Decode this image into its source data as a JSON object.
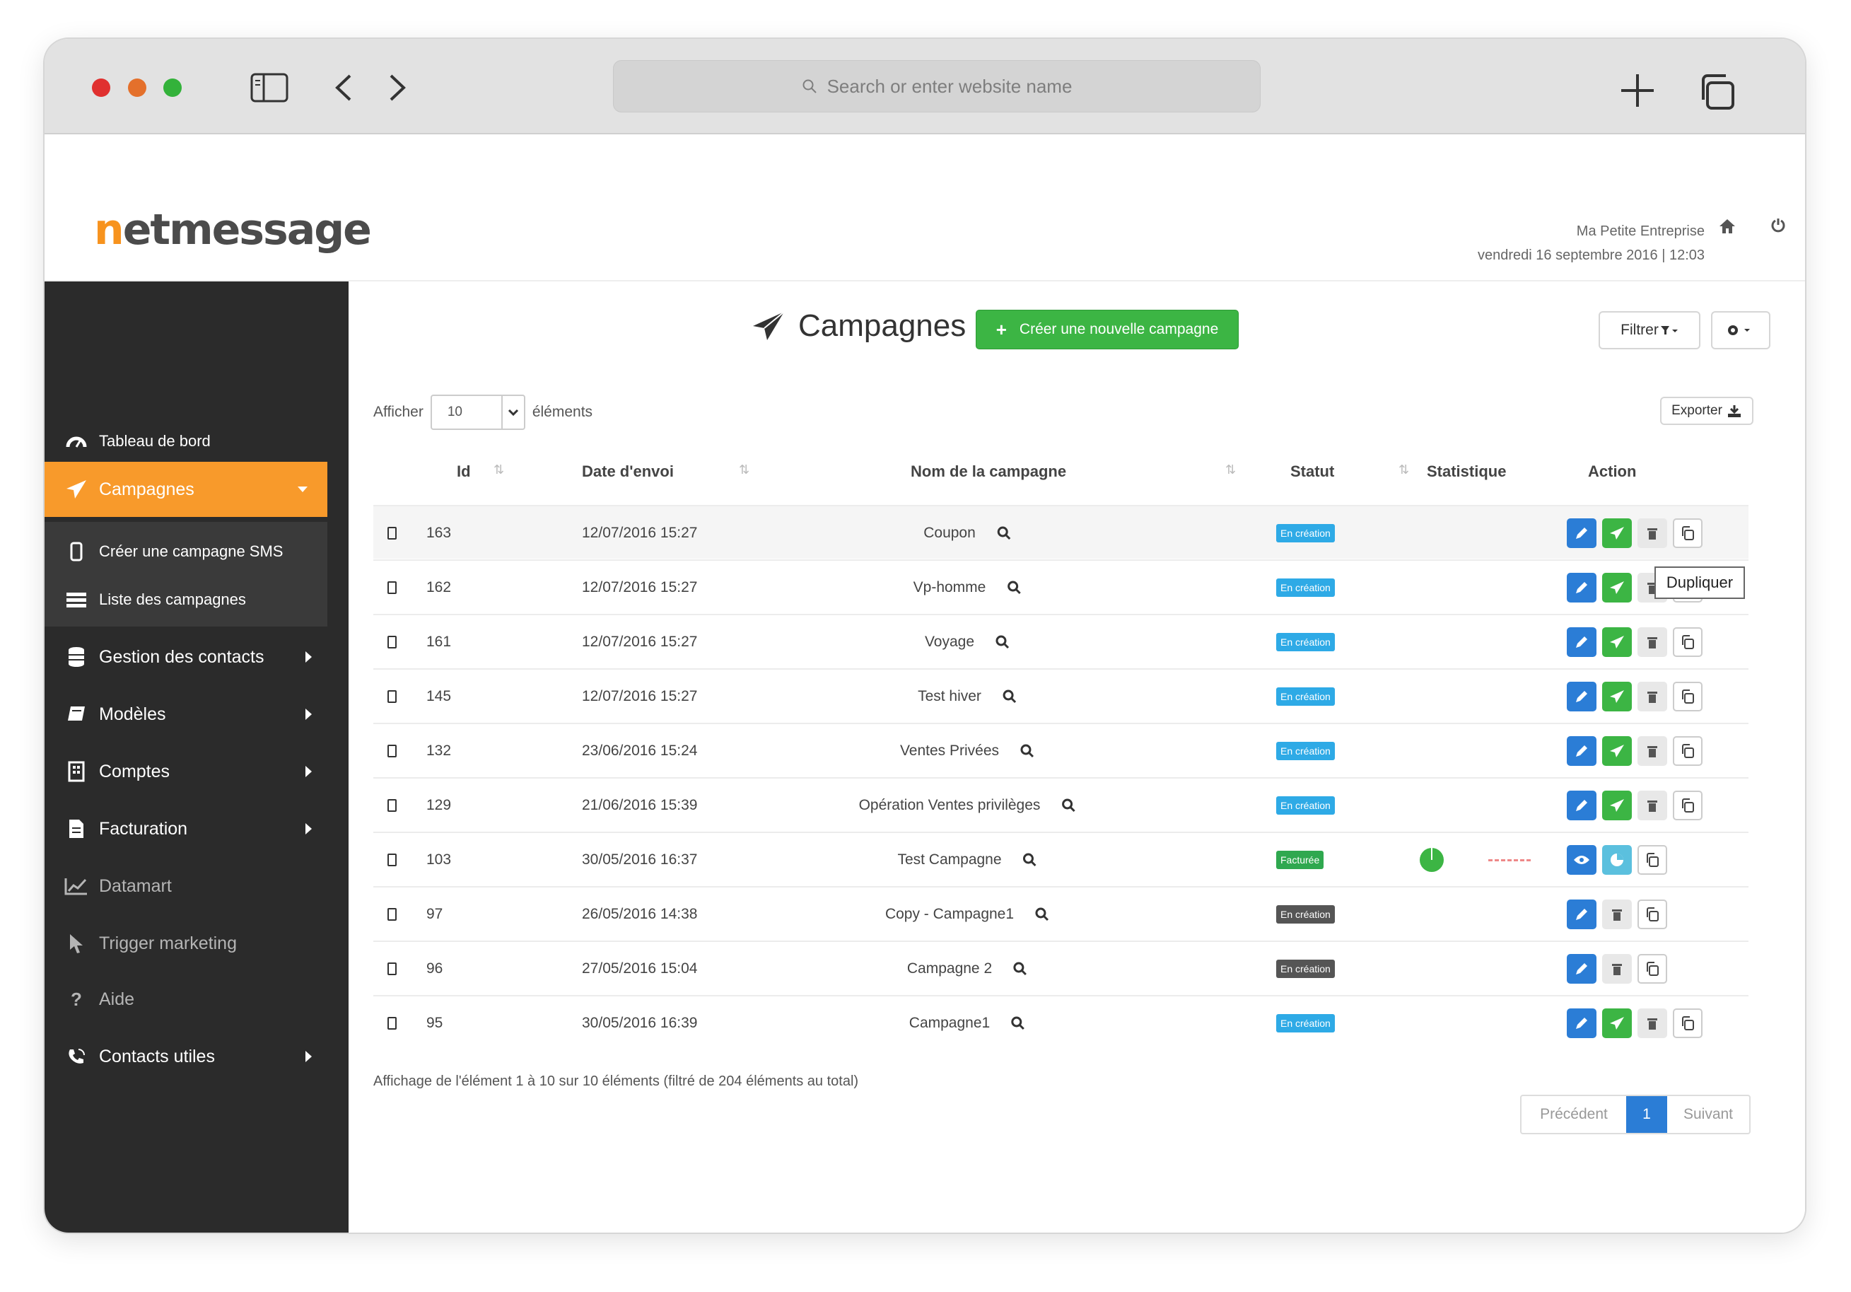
{
  "browser": {
    "url_placeholder": "Search or enter website name"
  },
  "header": {
    "logo": "netmessage",
    "company": "Ma Petite Entreprise",
    "datetime": "vendredi 16 septembre 2016 | 12:03"
  },
  "sidebar": {
    "items": [
      {
        "label": "Tableau de bord"
      },
      {
        "label": "Campagnes"
      },
      {
        "label": "Créer une campagne SMS"
      },
      {
        "label": "Liste des campagnes"
      },
      {
        "label": "Gestion des contacts"
      },
      {
        "label": "Modèles"
      },
      {
        "label": "Comptes"
      },
      {
        "label": "Facturation"
      },
      {
        "label": "Datamart"
      },
      {
        "label": "Trigger marketing"
      },
      {
        "label": "Aide"
      },
      {
        "label": "Contacts utiles"
      }
    ]
  },
  "main": {
    "title": "Campagnes",
    "create_button": "Créer une nouvelle campagne",
    "filter_button": "Filtrer",
    "show_label": "Afficher",
    "show_value": "10",
    "show_suffix": "éléments",
    "export_button": "Exporter",
    "columns": [
      "Id",
      "Date d'envoi",
      "Nom de la campagne",
      "Statut",
      "Statistique",
      "Action"
    ],
    "rows": [
      {
        "id": "163",
        "date": "12/07/2016 15:27",
        "name": "Coupon",
        "status": "En création"
      },
      {
        "id": "162",
        "date": "12/07/2016 15:27",
        "name": "Vp-homme",
        "status": "En création"
      },
      {
        "id": "161",
        "date": "12/07/2016 15:27",
        "name": "Voyage",
        "status": "En création"
      },
      {
        "id": "145",
        "date": "12/07/2016 15:27",
        "name": "Test hiver",
        "status": "En création"
      },
      {
        "id": "132",
        "date": "23/06/2016 15:24",
        "name": "Ventes Privées",
        "status": "En création"
      },
      {
        "id": "129",
        "date": "21/06/2016 15:39",
        "name": "Opération Ventes privilèges",
        "status": "En création"
      },
      {
        "id": "103",
        "date": "30/05/2016 16:37",
        "name": "Test Campagne",
        "status": "Facturée"
      },
      {
        "id": "97",
        "date": "26/05/2016 14:38",
        "name": "Copy - Campagne1",
        "status": "En création"
      },
      {
        "id": "96",
        "date": "27/05/2016 15:04",
        "name": "Campagne 2",
        "status": "En création"
      },
      {
        "id": "95",
        "date": "30/05/2016 16:39",
        "name": "Campagne1",
        "status": "En création"
      }
    ],
    "tooltip": "Dupliquer",
    "info": "Affichage de l'élément 1 à 10 sur 10 éléments (filtré de 204 éléments au total)",
    "pager": {
      "prev": "Précédent",
      "page": "1",
      "next": "Suivant"
    }
  },
  "colors": {
    "accent_orange": "#f89a2b",
    "sidebar_bg": "#2b2b2b",
    "create_green": "#3cb544",
    "status_blue": "#2eaae6",
    "status_dark": "#555555",
    "edit_blue": "#2b7dd6"
  }
}
